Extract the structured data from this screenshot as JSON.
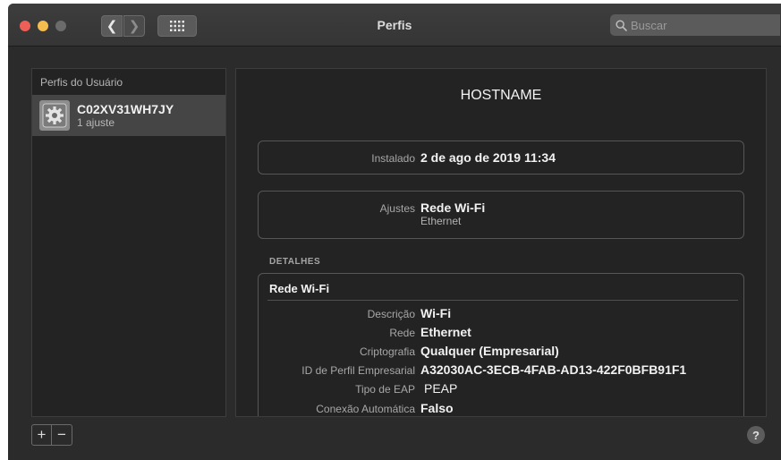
{
  "window": {
    "title": "Perfis"
  },
  "search": {
    "placeholder": "Buscar"
  },
  "sidebar": {
    "header": "Perfis do Usuário",
    "items": [
      {
        "name": "C02XV31WH7JY",
        "subtitle": "1 ajuste"
      }
    ]
  },
  "main": {
    "hostname": "HOSTNAME",
    "installed": {
      "label": "Instalado",
      "value": "2 de ago de 2019 11:34"
    },
    "settings": {
      "label": "Ajustes",
      "value": "Rede Wi-Fi",
      "sub": "Ethernet"
    },
    "details": {
      "section_label": "DETALHES",
      "title": "Rede Wi-Fi",
      "rows": [
        {
          "label": "Descrição",
          "value": "Wi-Fi"
        },
        {
          "label": "Rede",
          "value": "Ethernet"
        },
        {
          "label": "Criptografia",
          "value": "Qualquer (Empresarial)"
        },
        {
          "label": "ID de Perfil Empresarial",
          "value": "A32030AC-3ECB-4FAB-AD13-422F0BFB91F1"
        },
        {
          "label": "Tipo de EAP",
          "value": "PEAP"
        },
        {
          "label": "Conexão Automática",
          "value": "Falso"
        }
      ]
    }
  },
  "buttons": {
    "add": "+",
    "remove": "−",
    "help": "?"
  },
  "colors": {
    "close": "#ed5f57",
    "minimize": "#f3bd4f",
    "background": "#2b2b2b"
  }
}
